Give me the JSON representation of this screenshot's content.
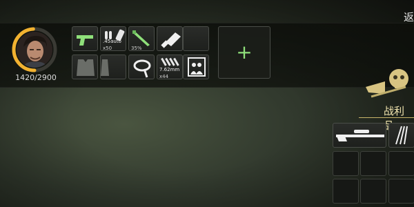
{
  "player": {
    "hp_text": "1420/2900",
    "hp_fraction": 0.49,
    "ring_color": "#f2b230"
  },
  "equipment": {
    "slots": [
      {
        "icon": "pistol-icon",
        "label": "",
        "count": ""
      },
      {
        "icon": "ammo-icon",
        "label": ".45auto",
        "count": "x50"
      },
      {
        "icon": "knife-icon",
        "label": "",
        "count": "35%"
      },
      {
        "icon": "flashlight-icon",
        "label": "",
        "count": ""
      },
      {
        "icon": "vest-icon",
        "label": "",
        "count": ""
      },
      {
        "icon": "bandage-icon",
        "label": "",
        "count": ""
      },
      {
        "icon": "rifle-ammo-icon",
        "label": "7.62mm",
        "count": "x44"
      },
      {
        "icon": "photo-icon",
        "label": "",
        "count": ""
      }
    ],
    "add_label": "+"
  },
  "header": {
    "back_label": "返"
  },
  "loot": {
    "title": "战利品",
    "items": [
      {
        "icon": "sniper-rifle-icon"
      },
      {
        "icon": "arrows-icon"
      }
    ]
  },
  "colors": {
    "accent_green": "#8fe07a",
    "loot_gold": "#f2e6b0"
  }
}
